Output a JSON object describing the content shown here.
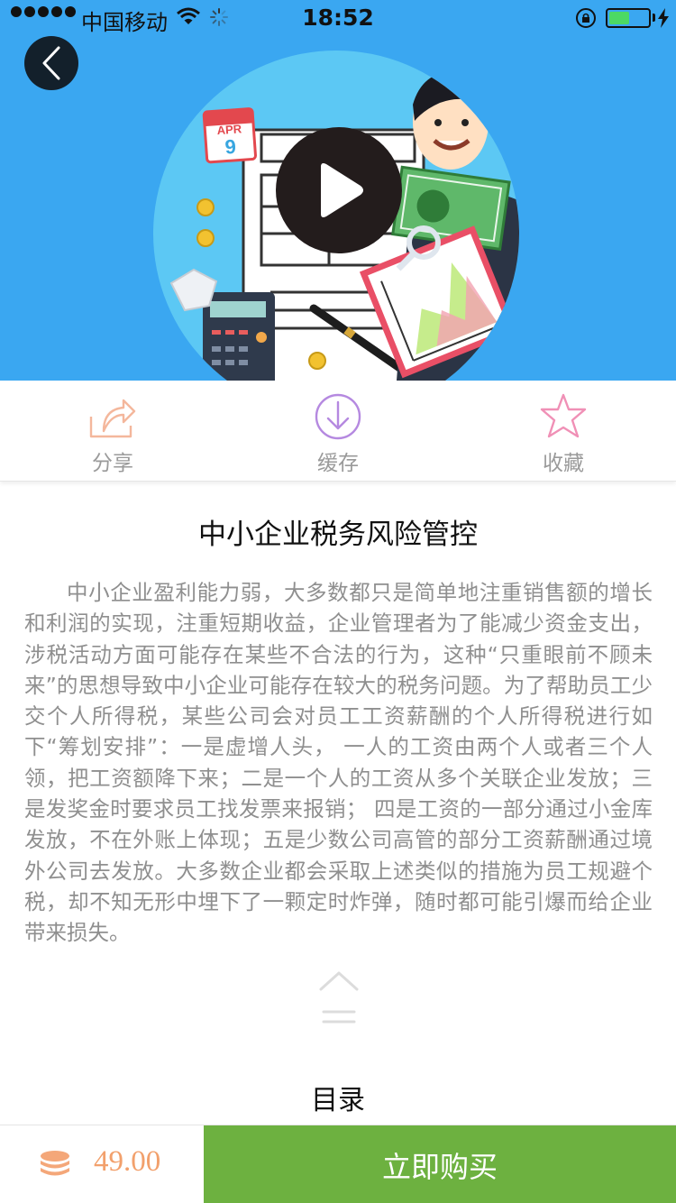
{
  "status_bar": {
    "carrier": "中国移动",
    "time": "18:52"
  },
  "colors": {
    "hero_bg": "#3aa7f1",
    "buy_button": "#6db140",
    "price": "#f2a06c",
    "share_icon": "#f4b79c",
    "cache_icon": "#b589e0",
    "favorite_icon": "#f090b6"
  },
  "actions": {
    "share": {
      "label": "分享",
      "icon": "share-icon"
    },
    "cache": {
      "label": "缓存",
      "icon": "download-icon"
    },
    "favorite": {
      "label": "收藏",
      "icon": "star-icon"
    }
  },
  "course": {
    "title": "中小企业税务风险管控",
    "description": "中小企业盈利能力弱，大多数都只是简单地注重销售额的增长和利润的实现，注重短期收益，企业管理者为了能减少资金支出，涉税活动方面可能存在某些不合法的行为，这种“只重眼前不顾未来”的思想导致中小企业可能存在较大的税务问题。为了帮助员工少交个人所得税，某些公司会对员工工资薪酬的个人所得税进行如下“筹划安排”：一是虚增人头， 一人的工资由两个人或者三个人领，把工资额降下来；二是一个人的工资从多个关联企业发放；三是发奖金时要求员工找发票来报销； 四是工资的一部分通过小金库发放，不在外账上体现；五是少数公司高管的部分工资薪酬通过境外公司去发放。大多数企业都会采取上述类似的措施为员工规避个税，却不知无形中埋下了一颗定时炸弹，随时都可能引爆而给企业带来损失。",
    "illustration_calendar_month": "APR",
    "illustration_calendar_day": "9"
  },
  "toc": {
    "label": "目录"
  },
  "purchase": {
    "price": "49.00",
    "buy_label": "立即购买"
  }
}
